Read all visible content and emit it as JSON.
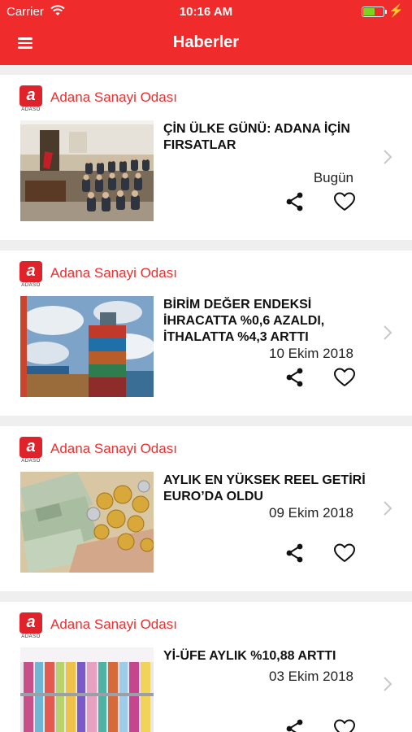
{
  "status_bar": {
    "carrier": "Carrier",
    "time": "10:16 AM",
    "battery_level": 0.55
  },
  "header": {
    "title": "Haberler"
  },
  "logo_lettering": {
    "mark": "a",
    "wordmark": "ADASO"
  },
  "colors": {
    "brand_red": "#f02b2b",
    "source_red": "#e83030",
    "battery_green": "#7ed321"
  },
  "icons": [
    "menu-icon",
    "wifi-icon",
    "battery-icon",
    "share-icon",
    "heart-icon",
    "chevron-right-icon"
  ],
  "news": [
    {
      "source": "Adana Sanayi Odası",
      "headline": "ÇİN ÜLKE GÜNÜ: ADANA İÇİN FIRSATLAR",
      "date": "Bugün"
    },
    {
      "source": "Adana Sanayi Odası",
      "headline": "BİRİM DEĞER ENDEKSİ İHRACATTA %0,6 AZALDI, İTHALATTA %4,3 ARTTI",
      "date": "10 Ekim 2018"
    },
    {
      "source": "Adana Sanayi Odası",
      "headline": "AYLIK EN YÜKSEK REEL GETİRİ EURO’DA OLDU",
      "date": "09 Ekim 2018"
    },
    {
      "source": "Adana Sanayi Odası",
      "headline": "Yİ-ÜFE AYLIK %10,88 ARTTI",
      "date": "03 Ekim 2018"
    }
  ]
}
